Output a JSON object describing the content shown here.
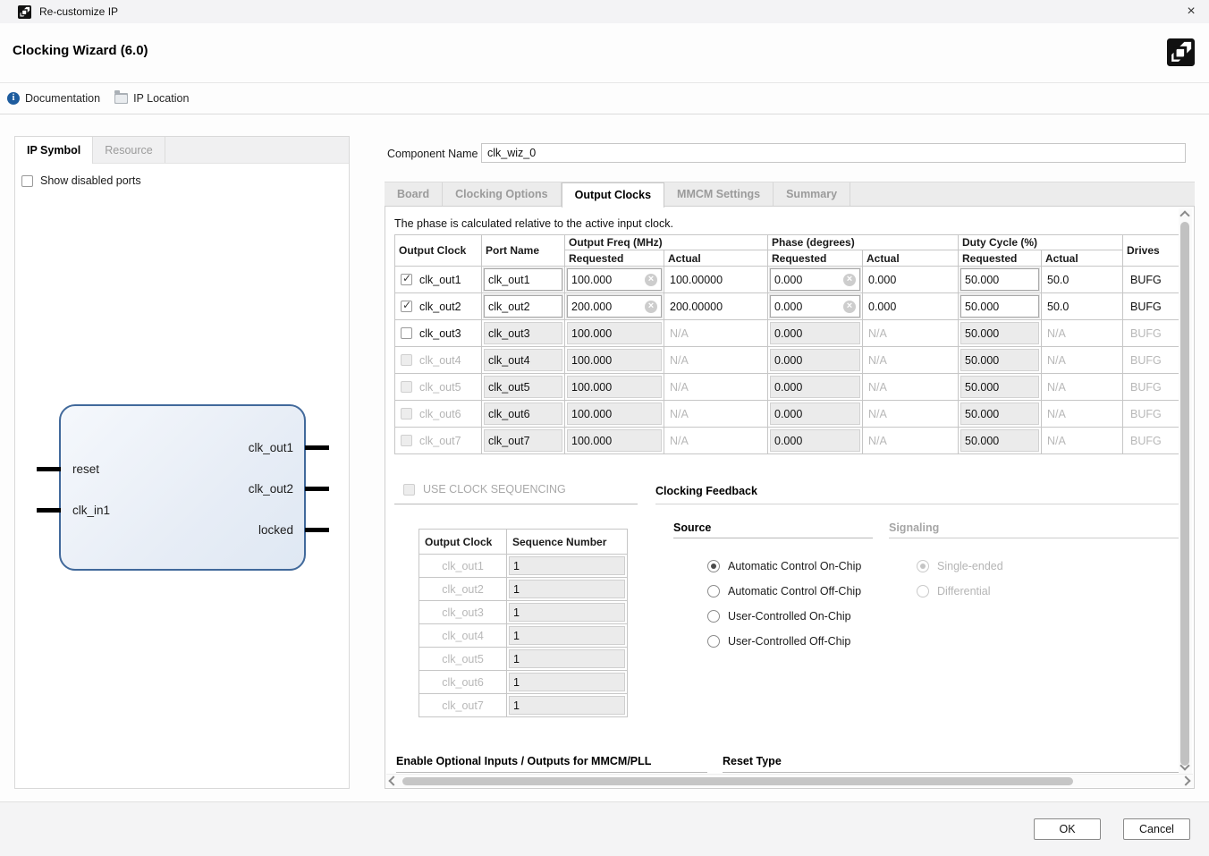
{
  "window": {
    "title": "Re-customize IP",
    "heading": "Clocking Wizard (6.0)",
    "close_glyph": "×",
    "toolbar": {
      "documentation": "Documentation",
      "ip_location": "IP Location"
    }
  },
  "left_panel": {
    "tabs": [
      {
        "label": "IP Symbol",
        "active": true
      },
      {
        "label": "Resource",
        "active": false
      }
    ],
    "show_disabled_ports": "Show disabled ports",
    "diagram": {
      "inputs": [
        "reset",
        "clk_in1"
      ],
      "outputs": [
        "clk_out1",
        "clk_out2",
        "locked"
      ]
    }
  },
  "component_name": {
    "label": "Component Name",
    "value": "clk_wiz_0"
  },
  "page_tabs": [
    {
      "label": "Board",
      "active": false
    },
    {
      "label": "Clocking Options",
      "active": false
    },
    {
      "label": "Output Clocks",
      "active": true
    },
    {
      "label": "MMCM Settings",
      "active": false
    },
    {
      "label": "Summary",
      "active": false
    }
  ],
  "output_clocks": {
    "note": "The phase is calculated relative to the active input clock.",
    "table": {
      "headers": {
        "output_clock": "Output Clock",
        "port_name": "Port Name",
        "output_freq": "Output Freq (MHz)",
        "phase": "Phase (degrees)",
        "duty_cycle": "Duty Cycle (%)",
        "requested": "Requested",
        "actual": "Actual",
        "drives": "Drives"
      },
      "rows": [
        {
          "name": "clk_out1",
          "checked": true,
          "editable": true,
          "disabled": false,
          "dim": false,
          "port": "clk_out1",
          "freq_req": "100.000",
          "freq_act": "100.00000",
          "phase_req": "0.000",
          "phase_act": "0.000",
          "duty_req": "50.000",
          "duty_act": "50.0",
          "drives": "BUFG"
        },
        {
          "name": "clk_out2",
          "checked": true,
          "editable": true,
          "disabled": false,
          "dim": false,
          "port": "clk_out2",
          "freq_req": "200.000",
          "freq_act": "200.00000",
          "phase_req": "0.000",
          "phase_act": "0.000",
          "duty_req": "50.000",
          "duty_act": "50.0",
          "drives": "BUFG"
        },
        {
          "name": "clk_out3",
          "checked": false,
          "editable": false,
          "disabled": true,
          "dim": false,
          "port": "clk_out3",
          "freq_req": "100.000",
          "freq_act": "N/A",
          "phase_req": "0.000",
          "phase_act": "N/A",
          "duty_req": "50.000",
          "duty_act": "N/A",
          "drives": "BUFG"
        },
        {
          "name": "clk_out4",
          "checked": false,
          "editable": false,
          "disabled": true,
          "dim": true,
          "port": "clk_out4",
          "freq_req": "100.000",
          "freq_act": "N/A",
          "phase_req": "0.000",
          "phase_act": "N/A",
          "duty_req": "50.000",
          "duty_act": "N/A",
          "drives": "BUFG"
        },
        {
          "name": "clk_out5",
          "checked": false,
          "editable": false,
          "disabled": true,
          "dim": true,
          "port": "clk_out5",
          "freq_req": "100.000",
          "freq_act": "N/A",
          "phase_req": "0.000",
          "phase_act": "N/A",
          "duty_req": "50.000",
          "duty_act": "N/A",
          "drives": "BUFG"
        },
        {
          "name": "clk_out6",
          "checked": false,
          "editable": false,
          "disabled": true,
          "dim": true,
          "port": "clk_out6",
          "freq_req": "100.000",
          "freq_act": "N/A",
          "phase_req": "0.000",
          "phase_act": "N/A",
          "duty_req": "50.000",
          "duty_act": "N/A",
          "drives": "BUFG"
        },
        {
          "name": "clk_out7",
          "checked": false,
          "editable": false,
          "disabled": true,
          "dim": true,
          "port": "clk_out7",
          "freq_req": "100.000",
          "freq_act": "N/A",
          "phase_req": "0.000",
          "phase_act": "N/A",
          "duty_req": "50.000",
          "duty_act": "N/A",
          "drives": "BUFG"
        }
      ]
    },
    "use_clock_sequencing": "USE CLOCK SEQUENCING",
    "sequence_table": {
      "headers": {
        "output_clock": "Output Clock",
        "sequence_number": "Sequence Number"
      },
      "rows": [
        {
          "name": "clk_out1",
          "value": "1"
        },
        {
          "name": "clk_out2",
          "value": "1"
        },
        {
          "name": "clk_out3",
          "value": "1"
        },
        {
          "name": "clk_out4",
          "value": "1"
        },
        {
          "name": "clk_out5",
          "value": "1"
        },
        {
          "name": "clk_out6",
          "value": "1"
        },
        {
          "name": "clk_out7",
          "value": "1"
        }
      ]
    },
    "clocking_feedback": {
      "title": "Clocking Feedback",
      "source": {
        "title": "Source",
        "options": [
          {
            "label": "Automatic Control On-Chip",
            "selected": true,
            "disabled": false
          },
          {
            "label": "Automatic Control Off-Chip",
            "selected": false,
            "disabled": false
          },
          {
            "label": "User-Controlled On-Chip",
            "selected": false,
            "disabled": false
          },
          {
            "label": "User-Controlled Off-Chip",
            "selected": false,
            "disabled": false
          }
        ]
      },
      "signaling": {
        "title": "Signaling",
        "options": [
          {
            "label": "Single-ended",
            "selected": true,
            "disabled": true
          },
          {
            "label": "Differential",
            "selected": false,
            "disabled": true
          }
        ]
      }
    },
    "bottom_sections": {
      "enable_optional": "Enable Optional Inputs / Outputs for MMCM/PLL",
      "reset_type": "Reset Type"
    }
  },
  "footer": {
    "ok": "OK",
    "cancel": "Cancel"
  }
}
